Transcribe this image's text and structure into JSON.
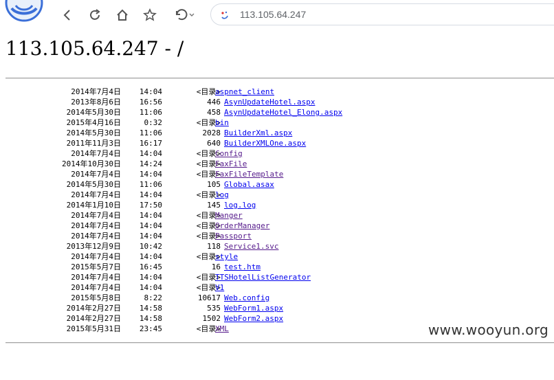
{
  "browser": {
    "url": "113.105.64.247",
    "icons": {
      "logo": "browser-logo",
      "back": "chevron-left-icon",
      "reload": "reload-icon",
      "home": "home-icon",
      "bookmark": "star-icon",
      "undo": "undo-icon",
      "site": "site-info-icon"
    }
  },
  "page": {
    "heading": "113.105.64.247 - /",
    "dir_label": "<目录>",
    "entries": [
      {
        "date": "2014年7月4日",
        "time": "14:04",
        "size": "",
        "is_dir": true,
        "name": "aspnet_client",
        "visited": false
      },
      {
        "date": "2013年8月6日",
        "time": "16:56",
        "size": "446",
        "is_dir": false,
        "name": "AsynUpdateHotel.aspx",
        "visited": false
      },
      {
        "date": "2014年5月30日",
        "time": "11:06",
        "size": "458",
        "is_dir": false,
        "name": "AsynUpdateHotel_Elong.aspx",
        "visited": false
      },
      {
        "date": "2015年4月16日",
        "time": "0:32",
        "size": "",
        "is_dir": true,
        "name": "bin",
        "visited": false
      },
      {
        "date": "2014年5月30日",
        "time": "11:06",
        "size": "2028",
        "is_dir": false,
        "name": "BuilderXml.aspx",
        "visited": false
      },
      {
        "date": "2011年11月3日",
        "time": "16:17",
        "size": "640",
        "is_dir": false,
        "name": "BuilderXMLOne.aspx",
        "visited": false
      },
      {
        "date": "2014年7月4日",
        "time": "14:04",
        "size": "",
        "is_dir": true,
        "name": "Config",
        "visited": true
      },
      {
        "date": "2014年10月30日",
        "time": "14:24",
        "size": "",
        "is_dir": true,
        "name": "FaxFile",
        "visited": true
      },
      {
        "date": "2014年7月4日",
        "time": "14:04",
        "size": "",
        "is_dir": true,
        "name": "FaxFileTemplate",
        "visited": true
      },
      {
        "date": "2014年5月30日",
        "time": "11:06",
        "size": "105",
        "is_dir": false,
        "name": "Global.asax",
        "visited": false
      },
      {
        "date": "2014年7月4日",
        "time": "14:04",
        "size": "",
        "is_dir": true,
        "name": "log",
        "visited": false
      },
      {
        "date": "2014年1月10日",
        "time": "17:50",
        "size": "145",
        "is_dir": false,
        "name": "log.log",
        "visited": false
      },
      {
        "date": "2014年7月4日",
        "time": "14:04",
        "size": "",
        "is_dir": true,
        "name": "Manger",
        "visited": true
      },
      {
        "date": "2014年7月4日",
        "time": "14:04",
        "size": "",
        "is_dir": true,
        "name": "OrderManager",
        "visited": true
      },
      {
        "date": "2014年7月4日",
        "time": "14:04",
        "size": "",
        "is_dir": true,
        "name": "Passport",
        "visited": true
      },
      {
        "date": "2013年12月9日",
        "time": "10:42",
        "size": "118",
        "is_dir": false,
        "name": "Service1.svc",
        "visited": true
      },
      {
        "date": "2014年7月4日",
        "time": "14:04",
        "size": "",
        "is_dir": true,
        "name": "style",
        "visited": false
      },
      {
        "date": "2015年5月7日",
        "time": "16:45",
        "size": "16",
        "is_dir": false,
        "name": "test.htm",
        "visited": false
      },
      {
        "date": "2014年7月4日",
        "time": "14:04",
        "size": "",
        "is_dir": true,
        "name": "TTSHotelListGenerator",
        "visited": false
      },
      {
        "date": "2014年7月4日",
        "time": "14:04",
        "size": "",
        "is_dir": true,
        "name": "V1",
        "visited": false
      },
      {
        "date": "2015年5月8日",
        "time": "8:22",
        "size": "10617",
        "is_dir": false,
        "name": "Web.config",
        "visited": false
      },
      {
        "date": "2014年2月27日",
        "time": "14:58",
        "size": "535",
        "is_dir": false,
        "name": "WebForm1.aspx",
        "visited": false
      },
      {
        "date": "2014年2月27日",
        "time": "14:58",
        "size": "1502",
        "is_dir": false,
        "name": "WebForm2.aspx",
        "visited": false
      },
      {
        "date": "2015年5月31日",
        "time": "23:45",
        "size": "",
        "is_dir": true,
        "name": "XML",
        "visited": true
      }
    ]
  },
  "watermark": "www.wooyun.org"
}
